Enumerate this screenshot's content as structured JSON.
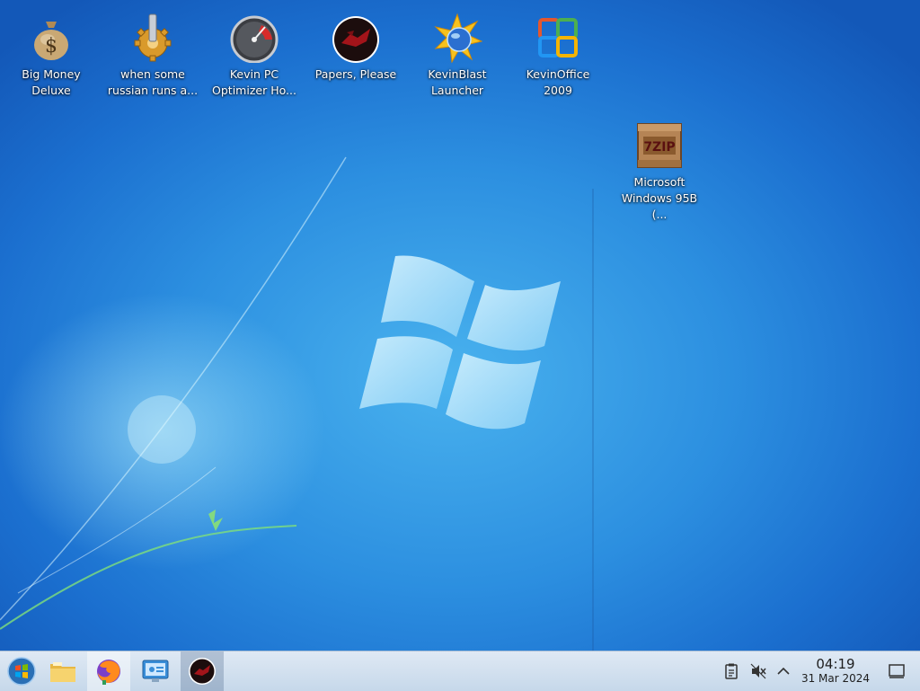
{
  "desktop": {
    "icons": [
      {
        "label": "Big Money\nDeluxe",
        "icon": "money-bag-icon"
      },
      {
        "label": "when some\nrussian runs a...",
        "icon": "gear-icon"
      },
      {
        "label": "Kevin PC\nOptimizer Ho...",
        "icon": "speedometer-icon"
      },
      {
        "label": "Papers, Please",
        "icon": "papers-please-icon"
      },
      {
        "label": "KevinBlast\nLauncher",
        "icon": "kevinblast-icon"
      },
      {
        "label": "KevinOffice\n2009",
        "icon": "office-icon"
      },
      {
        "label": "Microsoft\nWindows 95B (...",
        "icon": "7zip-archive-icon"
      }
    ]
  },
  "taskbar": {
    "start_icon": "start-orb-icon",
    "pinned": [
      {
        "name": "file-manager",
        "icon": "folder-icon"
      },
      {
        "name": "firefox",
        "icon": "firefox-icon"
      },
      {
        "name": "remote-desktop",
        "icon": "remote-desktop-icon"
      },
      {
        "name": "papers-please",
        "icon": "papers-please-icon"
      }
    ],
    "tray": {
      "icons": [
        "clipboard-icon",
        "volume-muted-icon",
        "chevron-up-icon",
        "show-desktop-icon"
      ],
      "time": "04:19",
      "date": "31 Mar 2024"
    }
  },
  "colors": {
    "wallpaper": "#1b6fcf",
    "taskbar": "#d3e2f1",
    "label": "#ffffff"
  }
}
